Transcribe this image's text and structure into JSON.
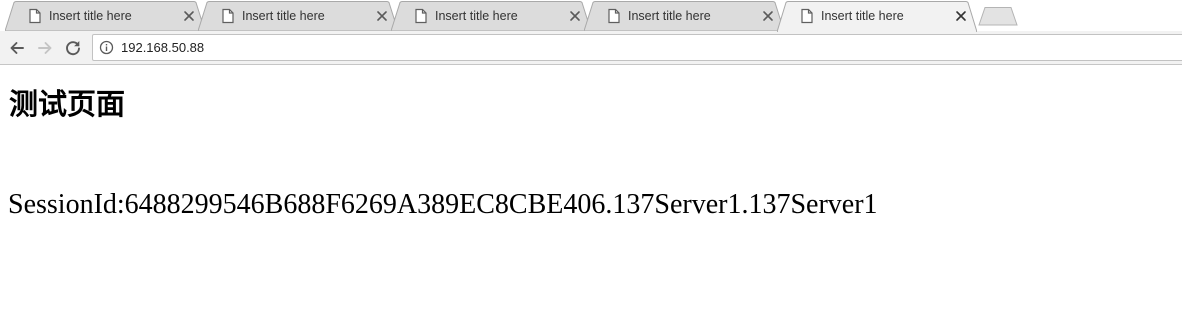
{
  "window": {
    "tabs": [
      {
        "title": "Insert title here",
        "active": false,
        "icon": "page-icon",
        "close_icon": "close-icon"
      },
      {
        "title": "Insert title here",
        "active": false,
        "icon": "page-icon",
        "close_icon": "close-icon"
      },
      {
        "title": "Insert title here",
        "active": false,
        "icon": "page-icon",
        "close_icon": "close-icon"
      },
      {
        "title": "Insert title here",
        "active": false,
        "icon": "page-icon",
        "close_icon": "close-icon"
      },
      {
        "title": "Insert title here",
        "active": true,
        "icon": "page-icon",
        "close_icon": "close-icon"
      }
    ],
    "new_tab_icon": "new-tab-icon"
  },
  "toolbar": {
    "back_icon": "back-arrow-icon",
    "forward_icon": "forward-arrow-icon",
    "reload_icon": "reload-icon",
    "site_info_icon": "info-icon",
    "url": "192.168.50.88"
  },
  "page": {
    "heading": "测试页面",
    "session_text": "SessionId:6488299546B688F6269A389EC8CBE406.137Server1.137Server1"
  },
  "colors": {
    "inactive_tab": "#dcdcdc",
    "active_tab": "#f2f2f2",
    "tab_border": "#a9a9a9",
    "toolbar": "#f2f2f2",
    "text": "#000000"
  }
}
